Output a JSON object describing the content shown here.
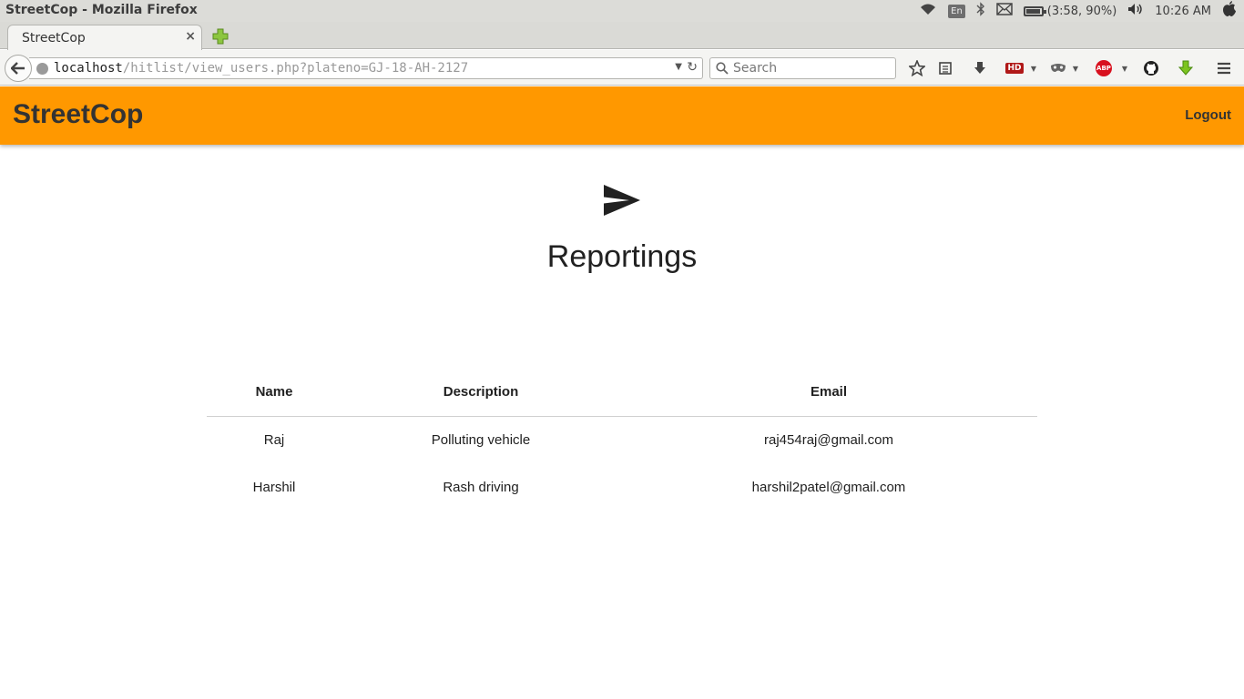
{
  "os": {
    "window_title": "StreetCop - Mozilla Firefox",
    "language": "En",
    "battery": "(3:58, 90%)",
    "clock": "10:26 AM"
  },
  "browser": {
    "tab_title": "StreetCop",
    "tab_close": "×",
    "url_host": "localhost",
    "url_path": "/hitlist/view_users.php?plateno=GJ-18-AH-2127",
    "search_placeholder": "Search",
    "hd_label": "HD",
    "abp_label": "ABP"
  },
  "app": {
    "brand": "StreetCop",
    "logout": "Logout",
    "accent_color": "#ff9800",
    "page_title": "Reportings",
    "table": {
      "headers": [
        "Name",
        "Description",
        "Email"
      ],
      "rows": [
        [
          "Raj",
          "Polluting vehicle",
          "raj454raj@gmail.com"
        ],
        [
          "Harshil",
          "Rash driving",
          "harshil2patel@gmail.com"
        ]
      ]
    }
  }
}
